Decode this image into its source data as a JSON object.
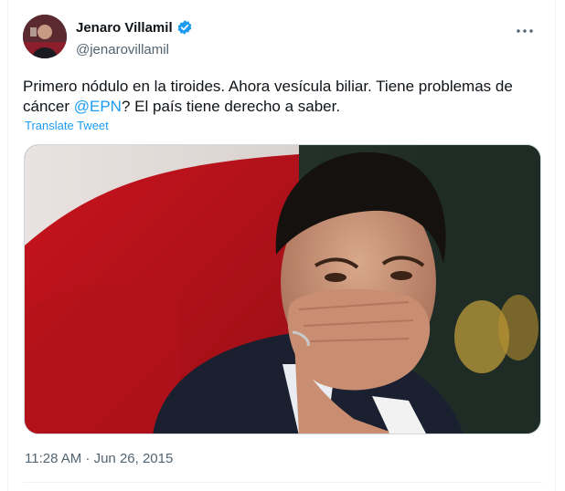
{
  "user": {
    "display_name": "Jenaro Villamil",
    "handle": "@jenarovillamil",
    "verified": true
  },
  "icons": {
    "verified": "verified-badge-icon",
    "more": "more-options-icon"
  },
  "tweet": {
    "text_before_mention": "Primero nódulo en la tiroides. Ahora vesícula biliar. Tiene problemas de cáncer ",
    "mention": "@EPN",
    "text_after_mention": "? El país tiene derecho a saber.",
    "translate_label": "Translate Tweet",
    "timestamp": "11:28 AM · Jun 26, 2015"
  },
  "colors": {
    "accent": "#1d9bf0",
    "text_primary": "#0f1419",
    "text_secondary": "#536471",
    "border": "#eff3f4"
  }
}
